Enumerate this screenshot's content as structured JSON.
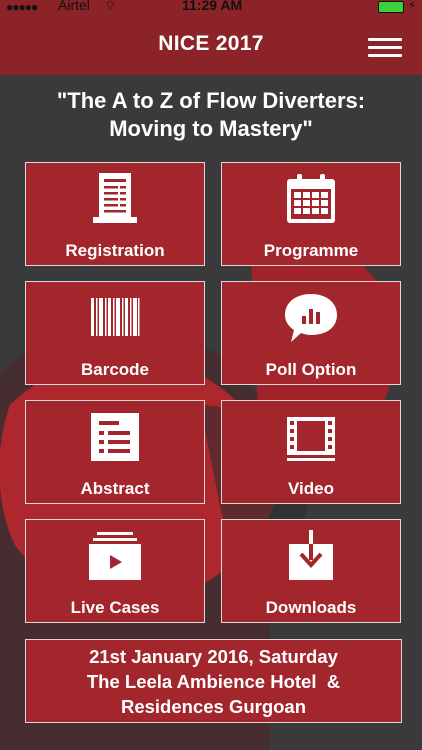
{
  "status_bar": {
    "carrier": "Airtel",
    "time": "11:29 AM"
  },
  "header": {
    "title": "NICE 2017"
  },
  "subtitle": {
    "line1": "\"The A to Z of Flow Diverters:",
    "line2": "Moving to Mastery\""
  },
  "tiles": [
    {
      "label": "Registration",
      "icon": "receipt-icon"
    },
    {
      "label": "Programme",
      "icon": "calendar-icon"
    },
    {
      "label": "Barcode",
      "icon": "barcode-icon"
    },
    {
      "label": "Poll Option",
      "icon": "poll-chat-icon"
    },
    {
      "label": "Abstract",
      "icon": "list-document-icon"
    },
    {
      "label": "Video",
      "icon": "film-icon"
    },
    {
      "label": "Live Cases",
      "icon": "video-stack-icon"
    },
    {
      "label": "Downloads",
      "icon": "download-icon"
    }
  ],
  "event": {
    "date": "21st January 2016, Saturday",
    "venue_line1": "The Leela Ambience Hotel  &",
    "venue_line2": "Residences Gurgoan"
  },
  "colors": {
    "brand": "#8b2329",
    "tile": "#a3262c",
    "background": "#3a3a3c",
    "battery": "#3cd13c"
  }
}
